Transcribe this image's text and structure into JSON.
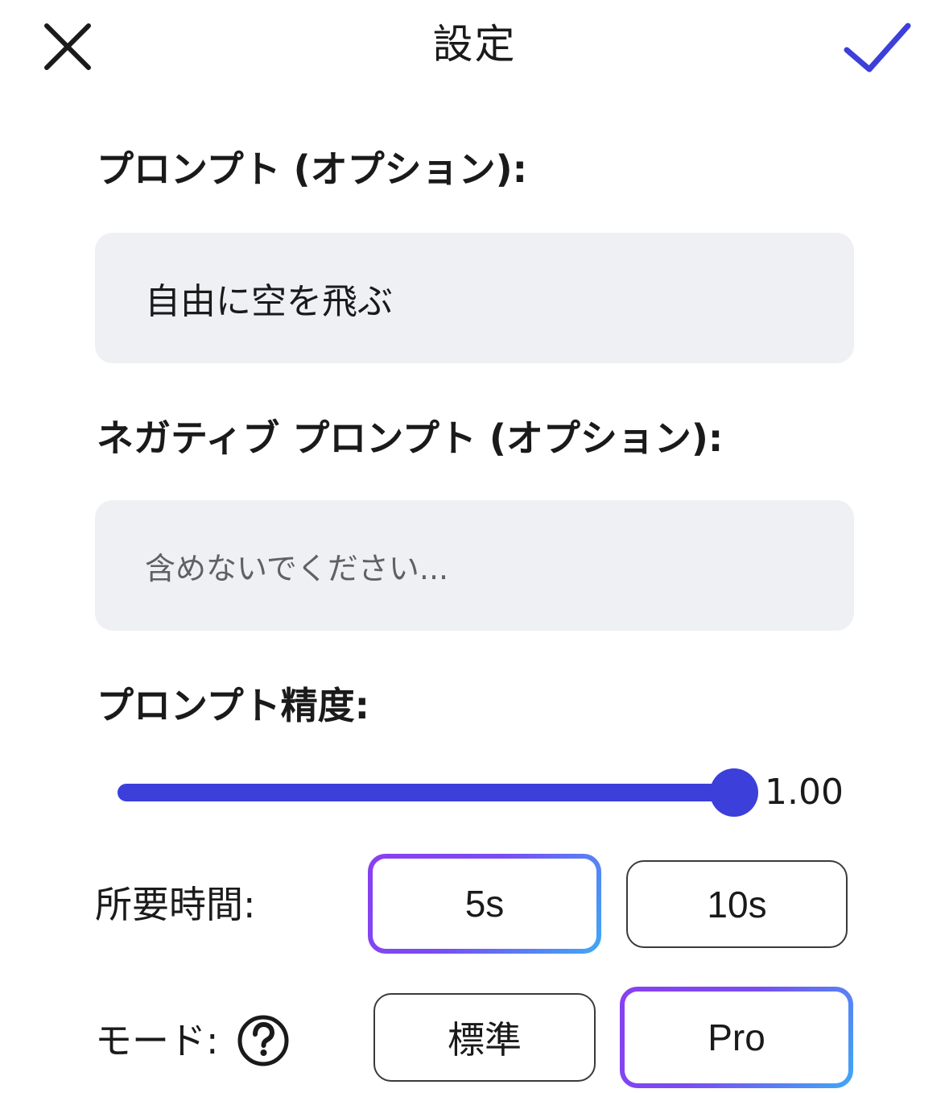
{
  "header": {
    "title": "設定",
    "close_icon": "close-x-icon",
    "confirm_icon": "checkmark-icon",
    "accent_color": "#3c3fd9"
  },
  "prompt": {
    "label": "プロンプト (オプション):",
    "value": "自由に空を飛ぶ"
  },
  "negative_prompt": {
    "label": "ネガティブ プロンプト (オプション):",
    "value": "",
    "placeholder": "含めないでください..."
  },
  "accuracy": {
    "label": "プロンプト精度:",
    "value_text": "1.00",
    "fraction": 1.0
  },
  "duration": {
    "label": "所要時間:",
    "options": [
      {
        "label": "5s",
        "selected": true
      },
      {
        "label": "10s",
        "selected": false
      }
    ]
  },
  "mode": {
    "label": "モード:",
    "help_icon": "question-circle-icon",
    "options": [
      {
        "label": "標準",
        "selected": false
      },
      {
        "label": "Pro",
        "selected": true
      }
    ]
  },
  "colors": {
    "field_background": "#eef0f4",
    "selected_gradient_start": "#8a3ff0",
    "selected_gradient_end": "#3fa9f5"
  }
}
